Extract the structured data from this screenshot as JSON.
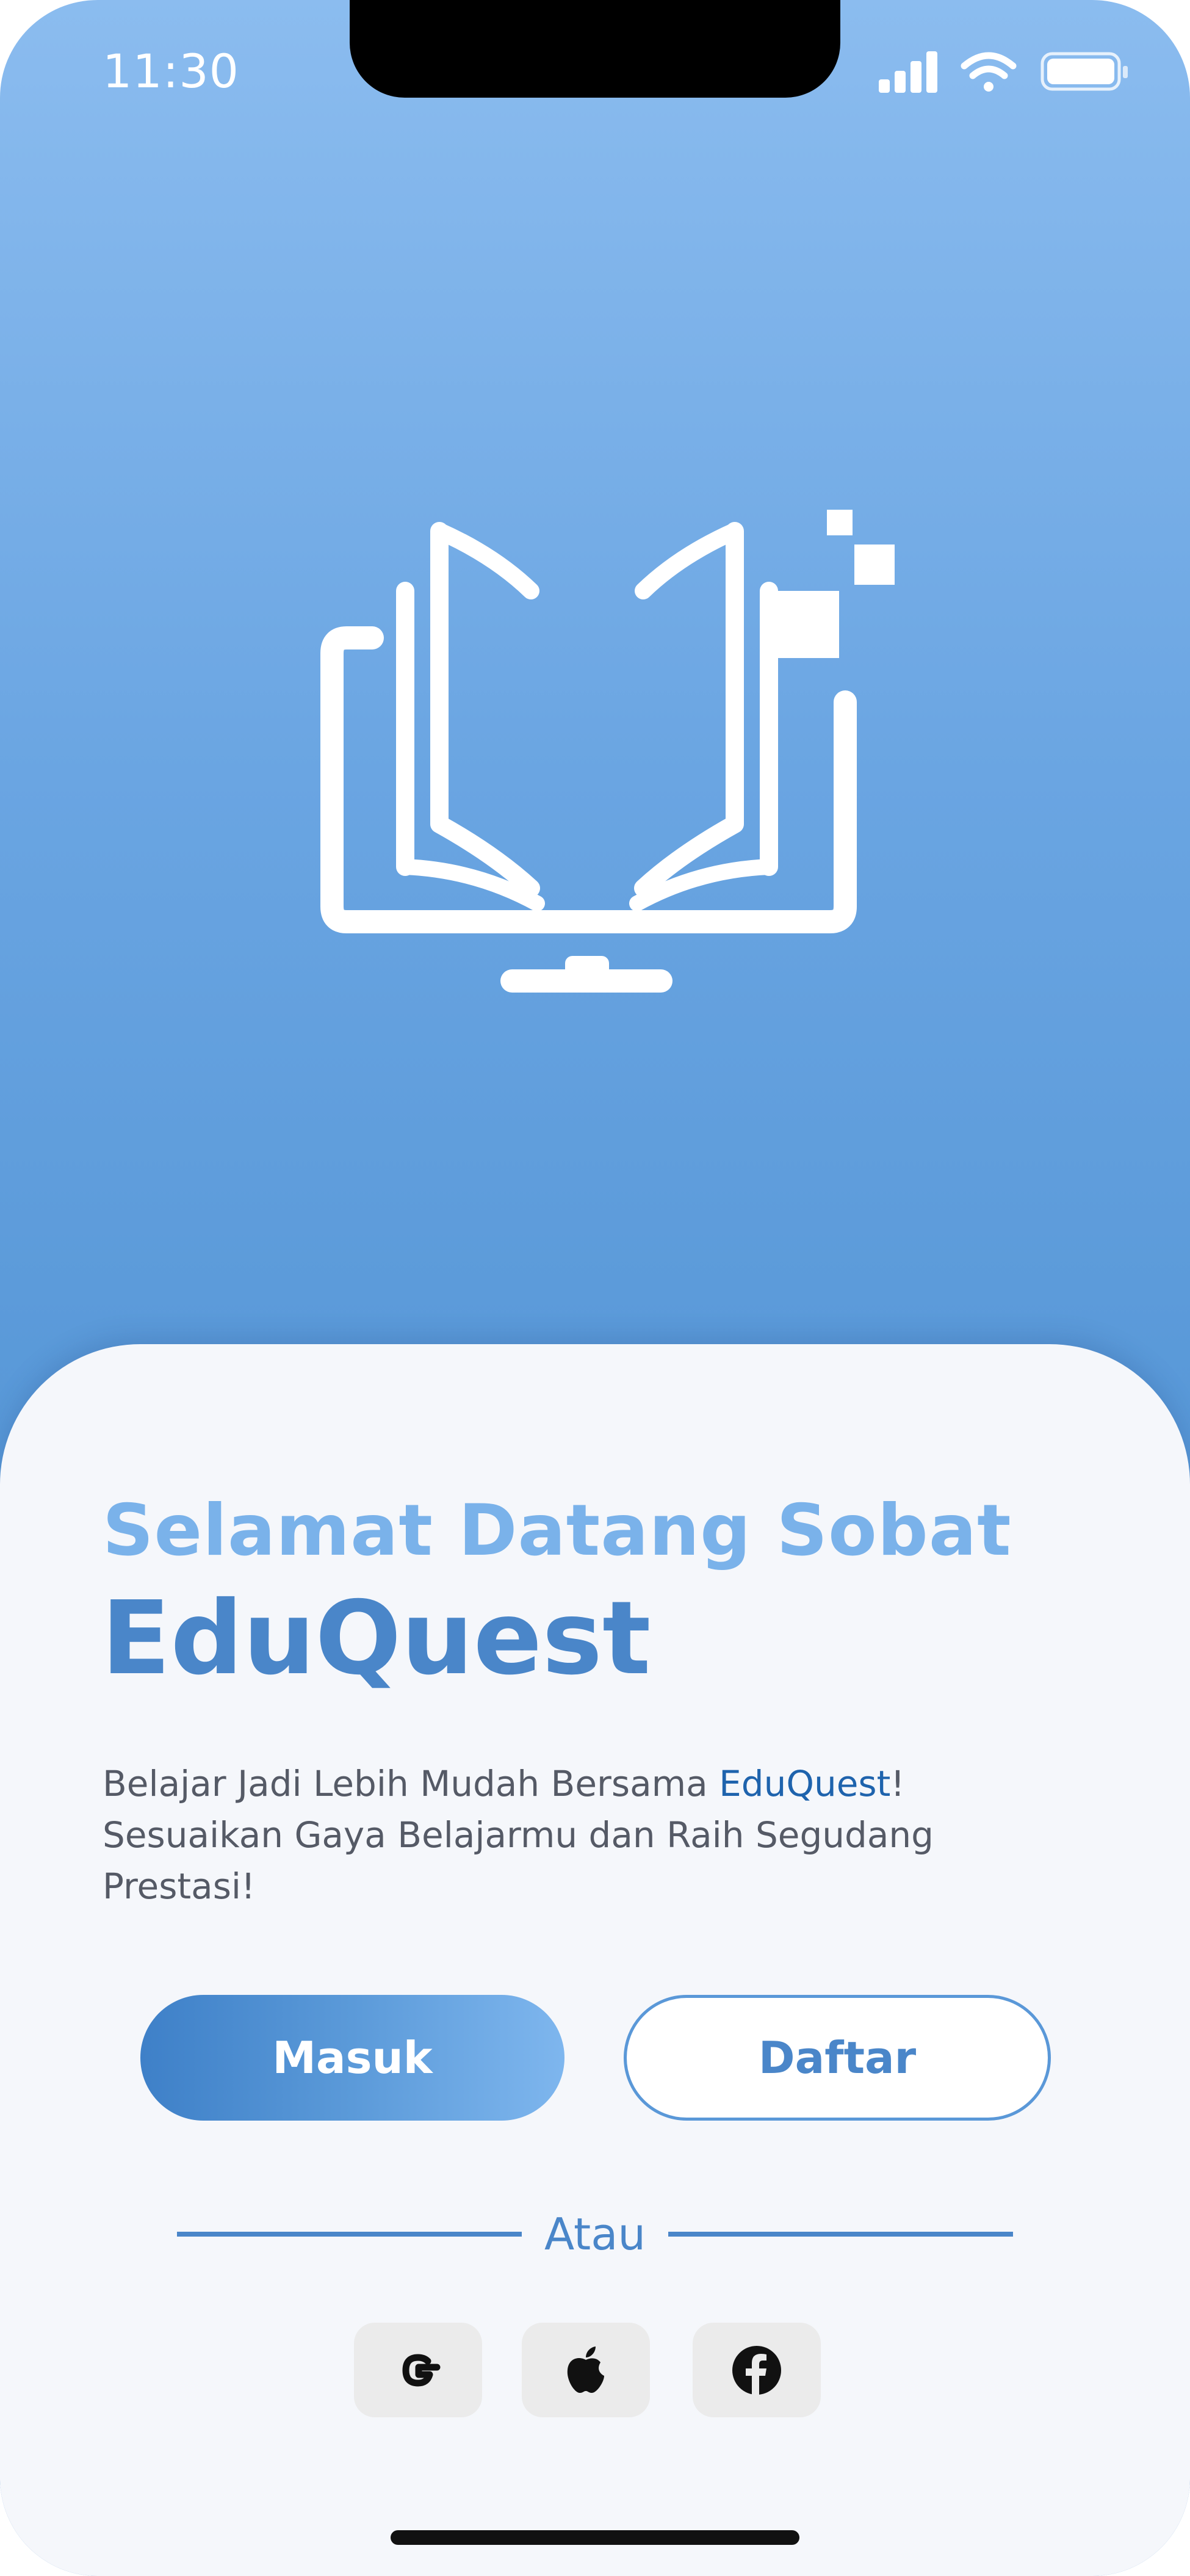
{
  "status_bar": {
    "time": "11:30",
    "icons": [
      "signal-icon",
      "wifi-icon",
      "battery-icon"
    ]
  },
  "logo": {
    "icon": "open-book-icon",
    "color": "#ffffff"
  },
  "welcome": {
    "line1": "Selamat Datang Sobat",
    "brand": "EduQuest"
  },
  "description": {
    "part1": "Belajar Jadi Lebih Mudah Bersama ",
    "brand": "EduQuest",
    "part2": "!",
    "line2": "Sesuaikan Gaya Belajarmu dan Raih Segudang",
    "line3": "Prestasi!"
  },
  "buttons": {
    "login_label": "Masuk",
    "register_label": "Daftar"
  },
  "divider_label": "Atau",
  "social": [
    {
      "icon": "google-icon"
    },
    {
      "icon": "apple-icon"
    },
    {
      "icon": "facebook-icon"
    }
  ],
  "colors": {
    "primary": "#4a86c9",
    "accent_light": "#7ab2ea",
    "brand_highlight": "#1e63ad",
    "sheet_background": "#f5f7fb",
    "gradient_top": "#8bbcef",
    "gradient_bottom": "#3f7fc6"
  }
}
